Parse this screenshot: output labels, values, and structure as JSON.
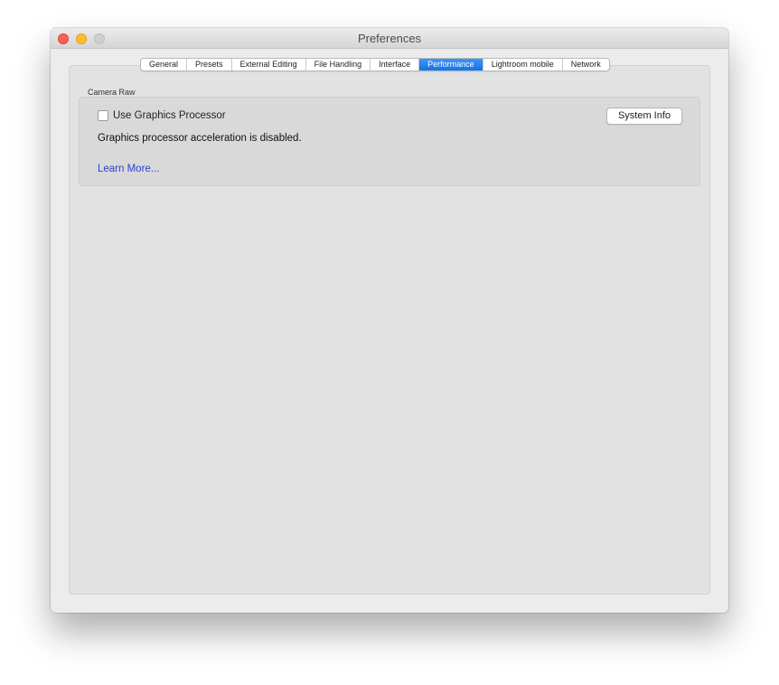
{
  "window": {
    "title": "Preferences"
  },
  "tabs": [
    {
      "label": "General",
      "active": false
    },
    {
      "label": "Presets",
      "active": false
    },
    {
      "label": "External Editing",
      "active": false
    },
    {
      "label": "File Handling",
      "active": false
    },
    {
      "label": "Interface",
      "active": false
    },
    {
      "label": "Performance",
      "active": true
    },
    {
      "label": "Lightroom mobile",
      "active": false
    },
    {
      "label": "Network",
      "active": false
    }
  ],
  "camera_raw": {
    "section_label": "Camera Raw",
    "checkbox_label": "Use Graphics Processor",
    "checkbox_checked": false,
    "system_info_label": "System Info",
    "status_text": "Graphics processor acceleration is disabled.",
    "learn_more_label": "Learn More..."
  },
  "colors": {
    "accent": "#1473e6",
    "link": "#2a3fd6",
    "close": "#fe5f57",
    "minimize": "#febc2e",
    "zoom_disabled": "#cfcfcf"
  }
}
